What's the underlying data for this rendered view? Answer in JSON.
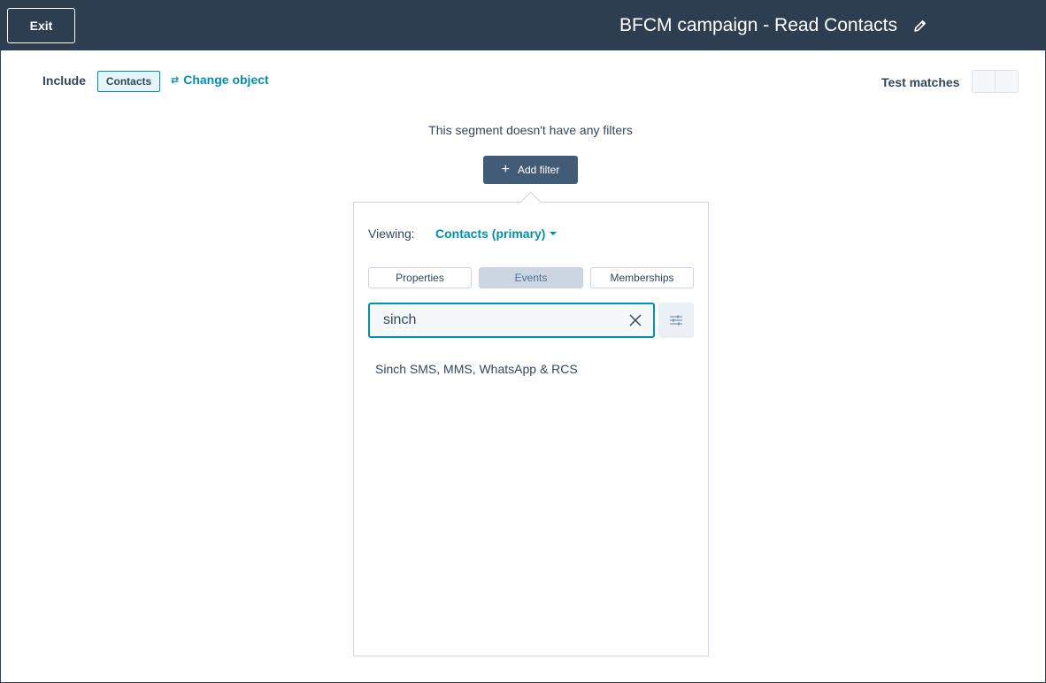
{
  "header": {
    "exit_label": "Exit",
    "title": "BFCM campaign - Read Contacts",
    "edit_icon": "pencil-icon"
  },
  "segment": {
    "include_label": "Include",
    "object_tag": "Contacts",
    "change_object_label": "Change object",
    "change_object_icon": "swap-arrows-icon",
    "test_matches_label": "Test matches",
    "empty_message": "This segment doesn't have any filters",
    "add_filter_label": "Add filter"
  },
  "filter_panel": {
    "viewing_label": "Viewing:",
    "viewing_value": "Contacts (primary)",
    "tabs": [
      {
        "label": "Properties",
        "active": false
      },
      {
        "label": "Events",
        "active": true
      },
      {
        "label": "Memberships",
        "active": false
      }
    ],
    "search_value": "sinch",
    "results": [
      {
        "label": "Sinch SMS, MMS, WhatsApp & RCS"
      }
    ]
  },
  "colors": {
    "topbar": "#2d3e50",
    "accent": "#0091ae",
    "primary_button": "#425b76",
    "text": "#33475b",
    "active_tab": "#cbd6e2"
  }
}
